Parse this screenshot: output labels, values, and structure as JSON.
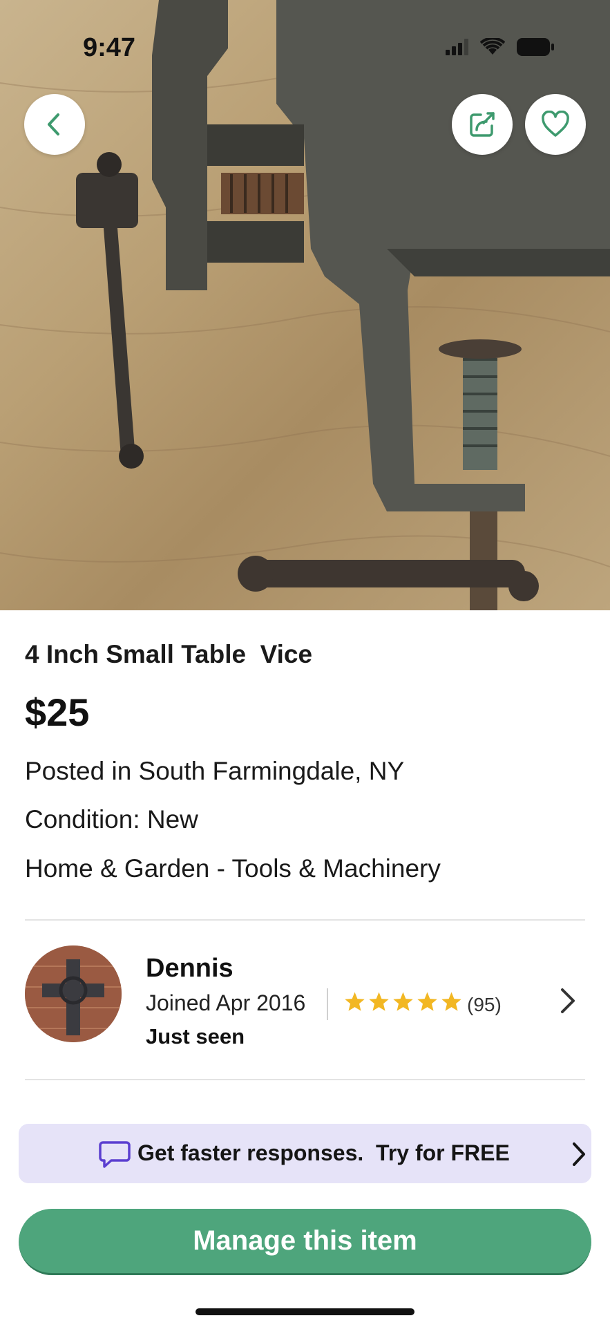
{
  "status_bar": {
    "time": "9:47"
  },
  "header": {
    "back_icon": "chevron-left-icon",
    "share_icon": "share-icon",
    "favorite_icon": "heart-outline-icon"
  },
  "listing": {
    "title": "4 Inch Small Table  Vice",
    "price": "$25",
    "posted": "Posted in South Farmingdale, NY",
    "condition": "Condition: New",
    "category": "Home & Garden - Tools & Machinery"
  },
  "seller": {
    "name": "Dennis",
    "joined": "Joined Apr 2016",
    "rating": 5,
    "rating_count": "(95)",
    "last_seen": "Just seen"
  },
  "promo": {
    "text": "Get faster responses.  Try for FREE",
    "icon": "chat-bubble-icon"
  },
  "actions": {
    "manage_label": "Manage this item"
  },
  "colors": {
    "accent_green": "#4ea57c",
    "star_gold": "#f2b723",
    "promo_bg": "#e6e3f8",
    "promo_icon": "#5b3fd0"
  }
}
